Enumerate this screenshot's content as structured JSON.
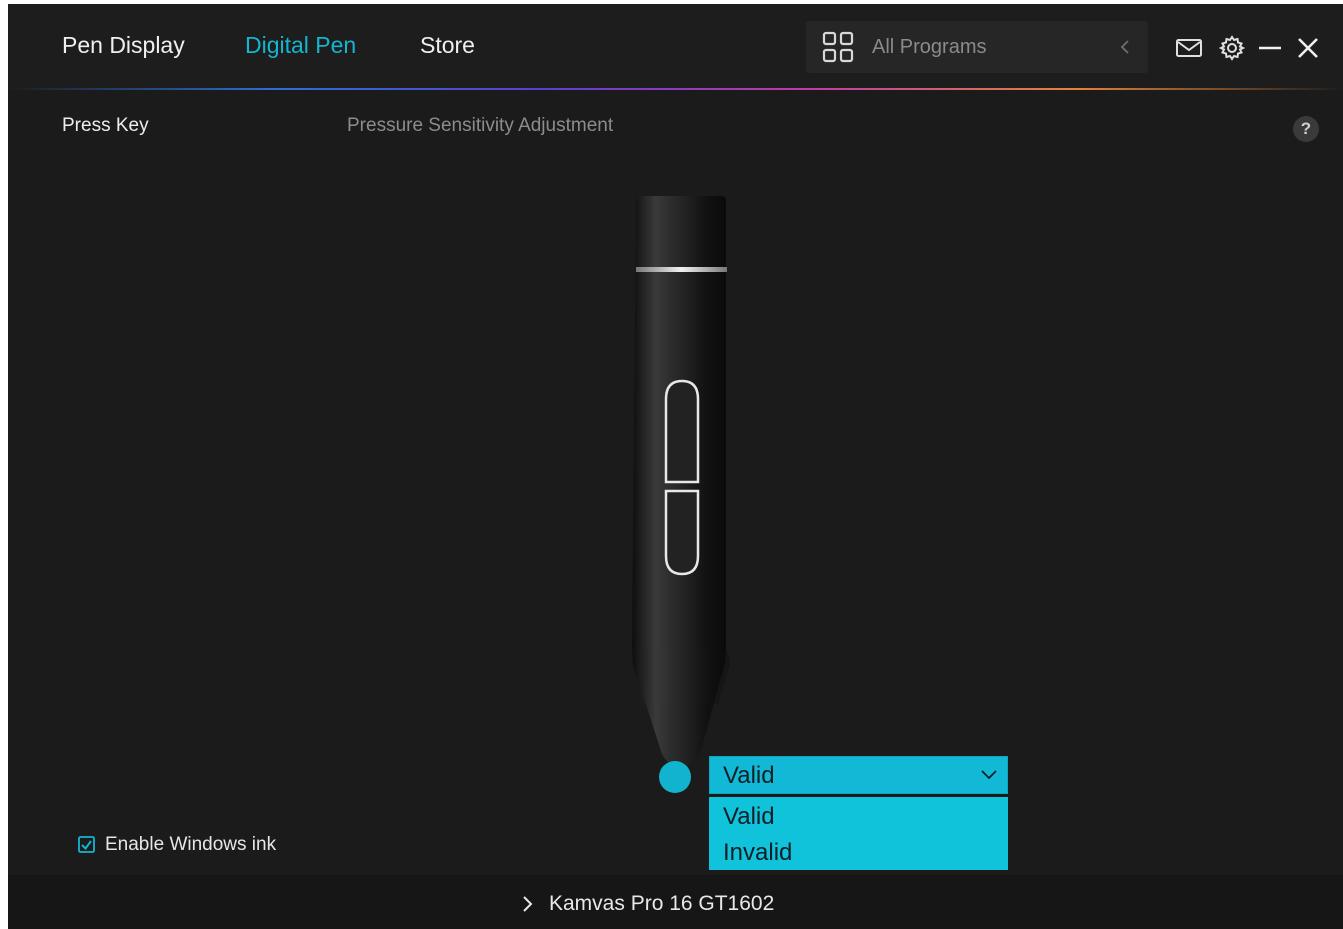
{
  "header": {
    "tabs": [
      {
        "label": "Pen Display",
        "active": false
      },
      {
        "label": "Digital Pen",
        "active": true
      },
      {
        "label": "Store",
        "active": false
      }
    ],
    "program_selector": {
      "label": "All Programs",
      "icon": "grid-icon"
    },
    "window_controls": [
      "mail-icon",
      "gear-icon",
      "minimize-icon",
      "close-icon"
    ]
  },
  "subtabs": [
    {
      "label": "Press Key",
      "active": true
    },
    {
      "label": "Pressure Sensitivity Adjustment",
      "active": false
    }
  ],
  "help": {
    "label": "?"
  },
  "pen_tip": {
    "selected": "Valid",
    "options": [
      "Valid",
      "Invalid"
    ]
  },
  "windows_ink": {
    "label": "Enable Windows ink",
    "checked": true
  },
  "footer": {
    "device": "Kamvas Pro 16 GT1602"
  },
  "colors": {
    "accent": "#15b5d0",
    "dropdown": "#12b9d6",
    "background": "#1b1b1b"
  }
}
